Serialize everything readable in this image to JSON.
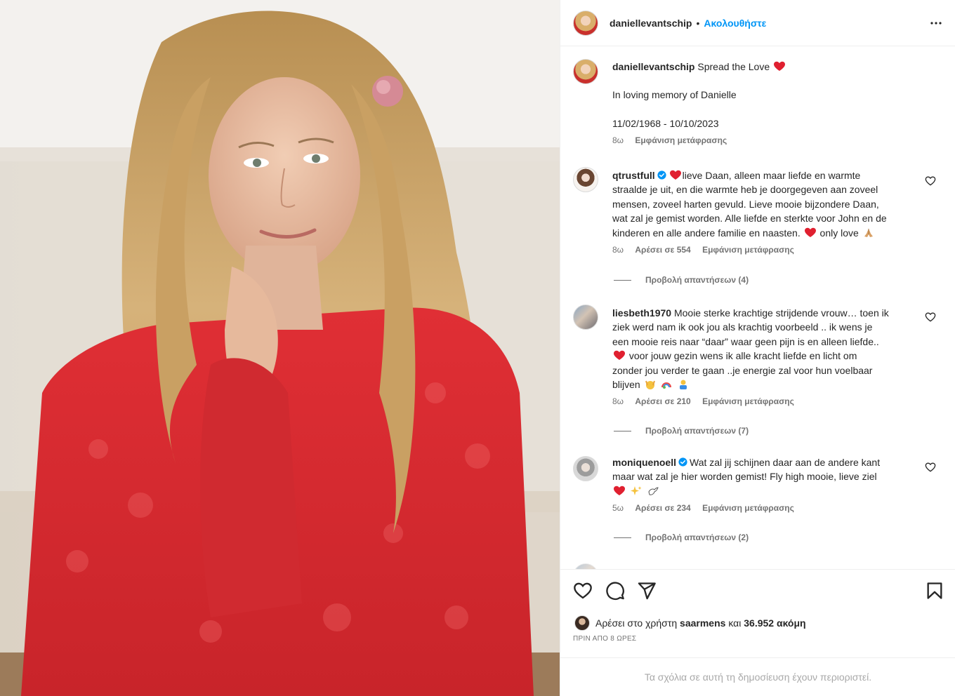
{
  "header": {
    "username": "daniellevantschip",
    "separator": "•",
    "follow_label": "Ακολουθήστε"
  },
  "caption": {
    "username": "daniellevantschip",
    "line1": "Spread the Love",
    "line2": "In loving memory of Danielle",
    "line3": "11/02/1968 - 10/10/2023",
    "time": "8ω",
    "translate": "Εμφάνιση μετάφρασης"
  },
  "comments": [
    {
      "username": "qtrustfull",
      "verified": true,
      "lines": [
        "lieve Daan, alleen maar liefde en warmte",
        "straalde je uit, en die warmte heb je doorgegeven aan zoveel",
        "mensen, zoveel harten gevuld. Lieve mooie bijzondere Daan,",
        "wat zal je gemist worden. Alle liefde en sterkte voor John en de",
        "kinderen en alle andere familie en naasten.",
        "only love"
      ],
      "time": "8ω",
      "likes": "Αρέσει σε 554",
      "translate": "Εμφάνιση μετάφρασης",
      "replies": "Προβολή απαντήσεων (4)"
    },
    {
      "username": "liesbeth1970",
      "verified": false,
      "lines": [
        "Mooie sterke krachtige strijdende vrouw… toen ik",
        "ziek werd nam ik ook jou als krachtig voorbeeld .. ik wens je",
        "een mooie reis naar “daar” waar geen pijn is en alleen liefde..",
        "voor jouw gezin wens ik alle kracht liefde en licht om",
        "zonder jou verder te gaan ..je energie zal voor hun voelbaar",
        "blijven"
      ],
      "time": "8ω",
      "likes": "Αρέσει σε 210",
      "translate": "Εμφάνιση μετάφρασης",
      "replies": "Προβολή απαντήσεων (7)"
    },
    {
      "username": "moniquenoell",
      "verified": true,
      "lines": [
        "Wat zal jij schijnen daar aan de andere kant",
        "maar wat zal je hier worden gemist! Fly high mooie, lieve ziel"
      ],
      "time": "5ω",
      "likes": "Αρέσει σε 234",
      "translate": "Εμφάνιση μετάφρασης",
      "replies": "Προβολή απαντήσεων (2)"
    }
  ],
  "likes_bar": {
    "prefix": "Αρέσει στο χρήστη",
    "user": "saarmens",
    "conj": "και",
    "count": "36.952 ακόμη",
    "time": "ΠΡΙΝ ΑΠΟ 8 ΩΡΕΣ"
  },
  "footer": {
    "restricted": "Τα σχόλια σε αυτή τη δημοσίευση έχουν περιοριστεί."
  },
  "icons": {
    "like": "heart-outline-icon",
    "comment": "comment-bubble-icon",
    "share": "paper-plane-icon",
    "save": "bookmark-icon",
    "more": "more-dots-icon",
    "verified": "verified-badge-icon"
  },
  "colors": {
    "link": "#0095f6",
    "heart": "#ed4956",
    "verified": "#0095f6",
    "muted": "#737373"
  }
}
